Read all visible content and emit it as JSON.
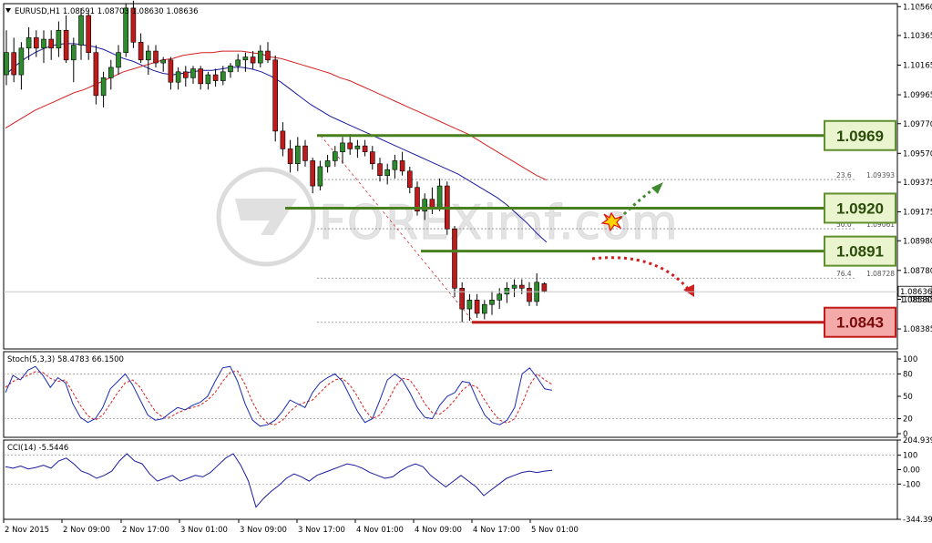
{
  "window": {
    "symbol_header": "EURUSD,H1  1.08691 1.08703 1.08630 1.08636",
    "watermark": "FOREXimf.com"
  },
  "colors": {
    "bull_candle": "#2e8b2e",
    "bear_candle": "#c01a1a",
    "ma_fast": "#1a1aa0",
    "ma_slow": "#d42020",
    "level_line": "#4a7f1e",
    "support_line": "#c01a1a",
    "badge_green_fill": "#eaf5cf",
    "badge_green_border": "#5f8f2e",
    "badge_red_fill": "#f5aaaa",
    "badge_red_border": "#c01a1a",
    "stoch_main": "#1a2ab0",
    "stoch_signal": "#d42020",
    "cci": "#1a1aa0"
  },
  "chart_data": [
    {
      "type": "candlestick",
      "title": "EURUSD,H1",
      "ylim": [
        1.0825,
        1.1058
      ],
      "price_scale": [
        "1.10560",
        "1.10365",
        "1.10165",
        "1.09965",
        "1.09770",
        "1.09570",
        "1.09375",
        "1.09175",
        "1.08980",
        "1.08780",
        "1.08585",
        "1.08385"
      ],
      "current_price": "1.08636",
      "current_price_overlap": "1.08580",
      "x_tick_labels": [
        "2 Nov 2015",
        "2 Nov 09:00",
        "2 Nov 17:00",
        "3 Nov 01:00",
        "3 Nov 09:00",
        "3 Nov 17:00",
        "4 Nov 01:00",
        "4 Nov 09:00",
        "4 Nov 17:00",
        "5 Nov 01:00"
      ],
      "candles": [
        [
          1.101,
          1.104,
          1.1003,
          1.1025
        ],
        [
          1.1025,
          1.1035,
          1.1005,
          1.101
        ],
        [
          1.101,
          1.1032,
          1.1,
          1.1028
        ],
        [
          1.1028,
          1.1042,
          1.102,
          1.1035
        ],
        [
          1.1035,
          1.104,
          1.1022,
          1.1028
        ],
        [
          1.1028,
          1.104,
          1.1018,
          1.1034
        ],
        [
          1.1034,
          1.104,
          1.102,
          1.1028
        ],
        [
          1.1028,
          1.1046,
          1.1022,
          1.104
        ],
        [
          1.104,
          1.105,
          1.1018,
          1.102
        ],
        [
          1.102,
          1.1035,
          1.1005,
          1.103
        ],
        [
          1.103,
          1.1055,
          1.102,
          1.105
        ],
        [
          1.105,
          1.1052,
          1.102,
          1.1025
        ],
        [
          1.1025,
          1.103,
          1.099,
          1.0996
        ],
        [
          1.0996,
          1.1012,
          1.0988,
          1.1008
        ],
        [
          1.1008,
          1.102,
          1.1,
          1.1015
        ],
        [
          1.1015,
          1.103,
          1.101,
          1.1025
        ],
        [
          1.1025,
          1.1058,
          1.1022,
          1.1055
        ],
        [
          1.1055,
          1.106,
          1.1028,
          1.1032
        ],
        [
          1.1032,
          1.1038,
          1.1018,
          1.102
        ],
        [
          1.102,
          1.103,
          1.101,
          1.1026
        ],
        [
          1.1026,
          1.103,
          1.1015,
          1.1018
        ],
        [
          1.1018,
          1.1022,
          1.1012,
          1.102
        ],
        [
          1.102,
          1.1022,
          1.1,
          1.1005
        ],
        [
          1.1005,
          1.1015,
          1.1,
          1.1012
        ],
        [
          1.1012,
          1.1016,
          1.1002,
          1.1008
        ],
        [
          1.1008,
          1.1016,
          1.1004,
          1.1014
        ],
        [
          1.1014,
          1.1016,
          1.1,
          1.1004
        ],
        [
          1.1004,
          1.1012,
          1.1,
          1.101
        ],
        [
          1.101,
          1.1014,
          1.1002,
          1.1006
        ],
        [
          1.1006,
          1.1016,
          1.1003,
          1.1012
        ],
        [
          1.1012,
          1.1018,
          1.1008,
          1.1016
        ],
        [
          1.1016,
          1.1024,
          1.1012,
          1.102
        ],
        [
          1.102,
          1.1025,
          1.1012,
          1.1022
        ],
        [
          1.1022,
          1.1026,
          1.1014,
          1.1018
        ],
        [
          1.1018,
          1.103,
          1.1015,
          1.1026
        ],
        [
          1.1026,
          1.1032,
          1.1018,
          1.102
        ],
        [
          1.102,
          1.1023,
          1.0965,
          1.0972
        ],
        [
          1.0972,
          1.0978,
          1.0955,
          1.096
        ],
        [
          1.096,
          1.0966,
          1.0944,
          1.095
        ],
        [
          1.095,
          1.0968,
          1.0945,
          1.0962
        ],
        [
          1.0962,
          1.0966,
          1.0948,
          1.0952
        ],
        [
          1.0952,
          1.0954,
          1.093,
          1.0935
        ],
        [
          1.0935,
          1.0952,
          1.0932,
          1.0948
        ],
        [
          1.0948,
          1.0956,
          1.0944,
          1.0952
        ],
        [
          1.0952,
          1.0962,
          1.0948,
          1.0958
        ],
        [
          1.0958,
          1.0968,
          1.095,
          1.0964
        ],
        [
          1.0964,
          1.097,
          1.0956,
          1.096
        ],
        [
          1.096,
          1.0966,
          1.0954,
          1.0962
        ],
        [
          1.0962,
          1.0966,
          1.0955,
          1.0958
        ],
        [
          1.0958,
          1.0962,
          1.0946,
          1.095
        ],
        [
          1.095,
          1.0954,
          1.0938,
          1.0942
        ],
        [
          1.0942,
          1.095,
          1.0936,
          1.0946
        ],
        [
          1.0946,
          1.0956,
          1.094,
          1.0952
        ],
        [
          1.0952,
          1.0958,
          1.0942,
          1.0945
        ],
        [
          1.0945,
          1.0948,
          1.093,
          1.0934
        ],
        [
          1.0934,
          1.0938,
          1.0915,
          1.0918
        ],
        [
          1.0918,
          1.093,
          1.0912,
          1.0926
        ],
        [
          1.0926,
          1.0934,
          1.0916,
          1.092
        ],
        [
          1.092,
          1.094,
          1.0918,
          1.0935
        ],
        [
          1.0935,
          1.0938,
          1.0902,
          1.0906
        ],
        [
          1.0906,
          1.0908,
          1.086,
          1.0866
        ],
        [
          1.0866,
          1.087,
          1.0843,
          1.0852
        ],
        [
          1.0852,
          1.0862,
          1.0844,
          1.0858
        ],
        [
          1.0858,
          1.0862,
          1.0846,
          1.0849
        ],
        [
          1.0849,
          1.0858,
          1.0845,
          1.0855
        ],
        [
          1.0855,
          1.0864,
          1.0848,
          1.0858
        ],
        [
          1.0858,
          1.0866,
          1.0852,
          1.0862
        ],
        [
          1.0862,
          1.087,
          1.0856,
          1.0866
        ],
        [
          1.0866,
          1.0872,
          1.086,
          1.0868
        ],
        [
          1.0868,
          1.0872,
          1.0862,
          1.0866
        ],
        [
          1.0866,
          1.087,
          1.0854,
          1.0857
        ],
        [
          1.0857,
          1.0876,
          1.0854,
          1.087
        ],
        [
          1.0869,
          1.087,
          1.0863,
          1.0864
        ]
      ],
      "ma_fast": [
        1.101,
        1.1016,
        1.1021,
        1.1025,
        1.1028,
        1.103,
        1.1031,
        1.1031,
        1.103,
        1.1029,
        1.1027,
        1.1024,
        1.1021,
        1.1019,
        1.1016,
        1.1013,
        1.1011,
        1.101,
        1.1011,
        1.1012,
        1.1013,
        1.1013,
        1.1014,
        1.1015,
        1.1015,
        1.1014,
        1.1012,
        1.1009,
        1.1005,
        1.1,
        1.0995,
        1.099,
        1.0986,
        1.0982,
        1.0979,
        1.0976,
        1.0973,
        1.097,
        1.0967,
        1.0964,
        1.0961,
        1.0958,
        1.0955,
        1.0952,
        1.0949,
        1.0946,
        1.0943,
        1.0939,
        1.0935,
        1.0931,
        1.0927,
        1.0922,
        1.0916,
        1.091,
        1.0903,
        1.0897
      ],
      "ma_slow": [
        1.0974,
        1.0978,
        1.0982,
        1.0986,
        1.0989,
        1.0992,
        1.0995,
        1.0998,
        1.1,
        1.1003,
        1.1006,
        1.1009,
        1.1012,
        1.1014,
        1.1016,
        1.1018,
        1.102,
        1.1021,
        1.1023,
        1.1024,
        1.1025,
        1.1025,
        1.1026,
        1.1026,
        1.1026,
        1.1025,
        1.1024,
        1.1022,
        1.1021,
        1.1019,
        1.1017,
        1.1015,
        1.1013,
        1.1011,
        1.1008,
        1.1006,
        1.1003,
        1.1,
        1.0997,
        1.0994,
        1.0991,
        1.0988,
        1.0985,
        1.0982,
        1.0979,
        1.0976,
        1.0973,
        1.097,
        1.0966,
        1.0962,
        1.0958,
        1.0954,
        1.095,
        1.0946,
        1.0942,
        1.0939
      ],
      "levels": [
        {
          "name": "resistance-1",
          "value": "1.0969",
          "style": "green"
        },
        {
          "name": "resistance-2",
          "value": "1.0920",
          "style": "green"
        },
        {
          "name": "resistance-3",
          "value": "1.0891",
          "style": "green"
        },
        {
          "name": "support-1",
          "value": "1.0843",
          "style": "red"
        }
      ],
      "fib_labels": [
        {
          "ratio": "23.6",
          "price": "1.09393"
        },
        {
          "ratio": "50.0",
          "price": "1.09061"
        },
        {
          "ratio": "76.4",
          "price": "1.08728"
        }
      ]
    },
    {
      "type": "line",
      "title": "Stoch(5,3,3) 58.4783 66.1500",
      "ylim": [
        0,
        100
      ],
      "y_tick_labels": [
        "100",
        "80",
        "50",
        "20",
        "0"
      ],
      "series": [
        {
          "name": "main",
          "values": [
            55,
            78,
            72,
            85,
            90,
            78,
            62,
            75,
            68,
            40,
            22,
            15,
            20,
            35,
            60,
            70,
            80,
            65,
            45,
            25,
            18,
            20,
            28,
            35,
            32,
            38,
            42,
            50,
            70,
            88,
            90,
            70,
            40,
            18,
            10,
            12,
            18,
            30,
            45,
            40,
            35,
            55,
            68,
            75,
            80,
            70,
            50,
            30,
            15,
            20,
            45,
            72,
            80,
            72,
            55,
            35,
            22,
            20,
            38,
            50,
            55,
            70,
            68,
            45,
            25,
            15,
            12,
            18,
            35,
            80,
            88,
            75,
            60,
            58
          ]
        },
        {
          "name": "signal",
          "values": [
            62,
            70,
            74,
            78,
            83,
            82,
            74,
            70,
            72,
            55,
            38,
            24,
            18,
            25,
            40,
            55,
            68,
            72,
            62,
            45,
            30,
            22,
            22,
            28,
            32,
            35,
            38,
            45,
            55,
            70,
            82,
            84,
            66,
            42,
            24,
            14,
            12,
            18,
            30,
            38,
            42,
            45,
            55,
            65,
            72,
            74,
            65,
            50,
            32,
            20,
            25,
            42,
            62,
            74,
            72,
            58,
            40,
            28,
            26,
            34,
            45,
            58,
            66,
            62,
            45,
            30,
            18,
            14,
            20,
            40,
            65,
            80,
            72,
            66
          ]
        }
      ]
    },
    {
      "type": "line",
      "title": "CCI(14) -5.5446",
      "ylim": [
        -344.3,
        205
      ],
      "y_tick_labels": [
        "204.939",
        "100",
        "0.00",
        "-100",
        "-344.393"
      ],
      "series": [
        {
          "name": "cci",
          "values": [
            20,
            10,
            25,
            5,
            15,
            30,
            10,
            60,
            80,
            40,
            -10,
            -30,
            -60,
            -40,
            -10,
            60,
            110,
            60,
            40,
            -30,
            -80,
            -60,
            -40,
            -80,
            -60,
            -40,
            -50,
            -20,
            30,
            80,
            110,
            30,
            -80,
            -260,
            -200,
            -150,
            -110,
            -60,
            -30,
            -50,
            -80,
            -40,
            -20,
            0,
            20,
            40,
            30,
            10,
            -20,
            -40,
            -60,
            -50,
            -10,
            20,
            40,
            20,
            -40,
            -80,
            -120,
            -80,
            -40,
            -80,
            -120,
            -180,
            -140,
            -100,
            -60,
            -40,
            -20,
            -10,
            -20,
            -10,
            -5
          ]
        }
      ]
    }
  ]
}
